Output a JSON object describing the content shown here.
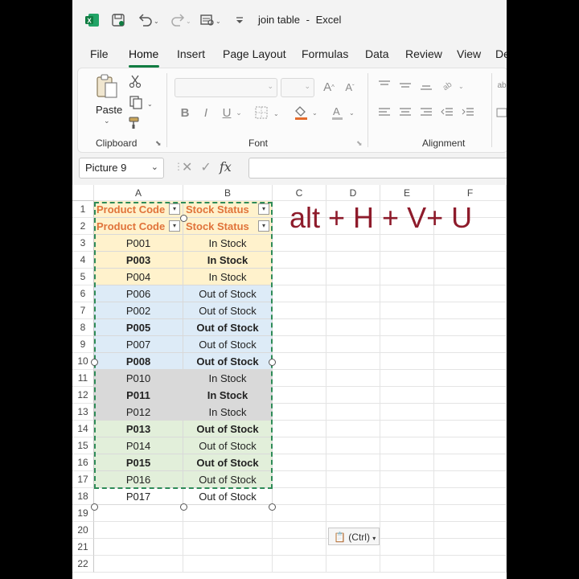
{
  "window": {
    "doc_name": "join table",
    "separator": "-",
    "app_name": "Excel"
  },
  "quick_access": {
    "excel_icon": "excel-logo-icon",
    "save_icon": "save-icon",
    "undo_icon": "undo-icon",
    "redo_icon": "redo-icon",
    "preview_icon": "print-preview-icon",
    "customize_icon": "customize-toolbar-icon"
  },
  "tabs": [
    "File",
    "Home",
    "Insert",
    "Page Layout",
    "Formulas",
    "Data",
    "Review",
    "View",
    "De"
  ],
  "active_tab": "Home",
  "ribbon": {
    "clipboard": {
      "label": "Clipboard",
      "paste_label": "Paste"
    },
    "font": {
      "label": "Font",
      "bold": "B",
      "italic": "I",
      "underline": "U"
    },
    "alignment": {
      "label": "Alignment"
    }
  },
  "formula_bar": {
    "name_box": "Picture 9",
    "fx_label": "fx",
    "formula": ""
  },
  "grid": {
    "columns": [
      "A",
      "B",
      "C",
      "D",
      "E",
      "F"
    ],
    "rows": [
      "1",
      "2",
      "3",
      "4",
      "5",
      "6",
      "7",
      "8",
      "9",
      "10",
      "11",
      "12",
      "13",
      "14",
      "15",
      "16",
      "17",
      "18",
      "19",
      "20",
      "21",
      "22"
    ],
    "header_row_1": [
      "Product Code",
      "Stock Status"
    ],
    "header_row_2": [
      "Product Code",
      "Stock Status"
    ],
    "data": [
      {
        "code": "P001",
        "status": "In Stock",
        "group": "yellow"
      },
      {
        "code": "P003",
        "status": "In Stock",
        "group": "yellow"
      },
      {
        "code": "P004",
        "status": "In Stock",
        "group": "yellow"
      },
      {
        "code": "P006",
        "status": "Out of Stock",
        "group": "blue"
      },
      {
        "code": "P002",
        "status": "Out of Stock",
        "group": "blue"
      },
      {
        "code": "P005",
        "status": "Out of Stock",
        "group": "blue"
      },
      {
        "code": "P007",
        "status": "Out of Stock",
        "group": "blue"
      },
      {
        "code": "P008",
        "status": "Out of Stock",
        "group": "blue"
      },
      {
        "code": "P010",
        "status": "In Stock",
        "group": "gray"
      },
      {
        "code": "P011",
        "status": "In Stock",
        "group": "gray"
      },
      {
        "code": "P012",
        "status": "In Stock",
        "group": "gray"
      },
      {
        "code": "P013",
        "status": "Out of Stock",
        "group": "green"
      },
      {
        "code": "P014",
        "status": "Out of Stock",
        "group": "green"
      },
      {
        "code": "P015",
        "status": "Out of Stock",
        "group": "green"
      },
      {
        "code": "P016",
        "status": "Out of Stock",
        "group": "green"
      },
      {
        "code": "P017",
        "status": "Out of Stock",
        "group": "white"
      }
    ]
  },
  "overlay": {
    "shortcut_text": "alt + H + V+ U",
    "paste_options": "(Ctrl)"
  },
  "colors": {
    "header_text": "#e0733a",
    "yellow": "#fff2cc",
    "blue": "#ddebf7",
    "gray": "#d9d9d9",
    "green": "#e2efda",
    "white": "#ffffff",
    "accent": "#107c41",
    "shortcut": "#8e1b2b"
  }
}
